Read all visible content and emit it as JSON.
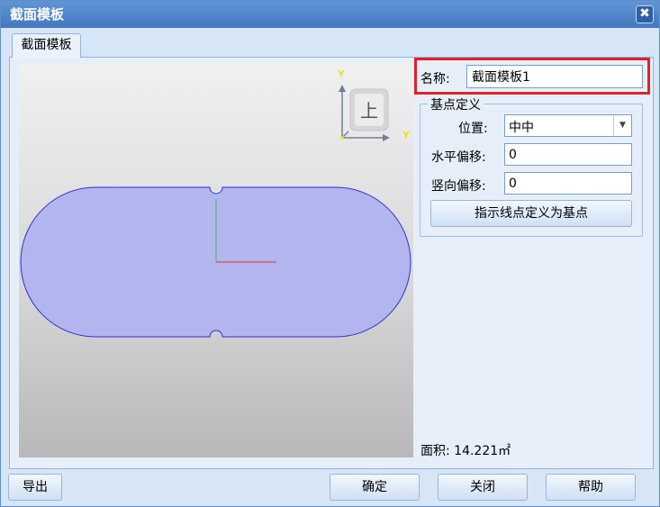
{
  "window": {
    "title": "截面模板",
    "close_glyph": "✖"
  },
  "tab": {
    "label": "截面模板"
  },
  "view_cube": {
    "face_label": "上",
    "axis_x": "Y",
    "axis_y": "Y"
  },
  "form": {
    "name_label": "名称:",
    "name_value": "截面模板1",
    "group_title": "基点定义",
    "position_label": "位置:",
    "position_value": "中中",
    "h_offset_label": "水平偏移:",
    "h_offset_value": "0",
    "v_offset_label": "竖向偏移:",
    "v_offset_value": "0",
    "define_button": "指示线点定义为基点"
  },
  "area": {
    "label": "面积:",
    "value": "14.221㎡"
  },
  "footer": {
    "export": "导出",
    "ok": "确定",
    "close": "关闭",
    "help": "帮助"
  },
  "colors": {
    "shape_fill": "#b3b6ee",
    "shape_stroke": "#2b2fd6",
    "axis_x": "#e03030",
    "axis_y": "#30c060",
    "highlight": "#e0202a"
  }
}
